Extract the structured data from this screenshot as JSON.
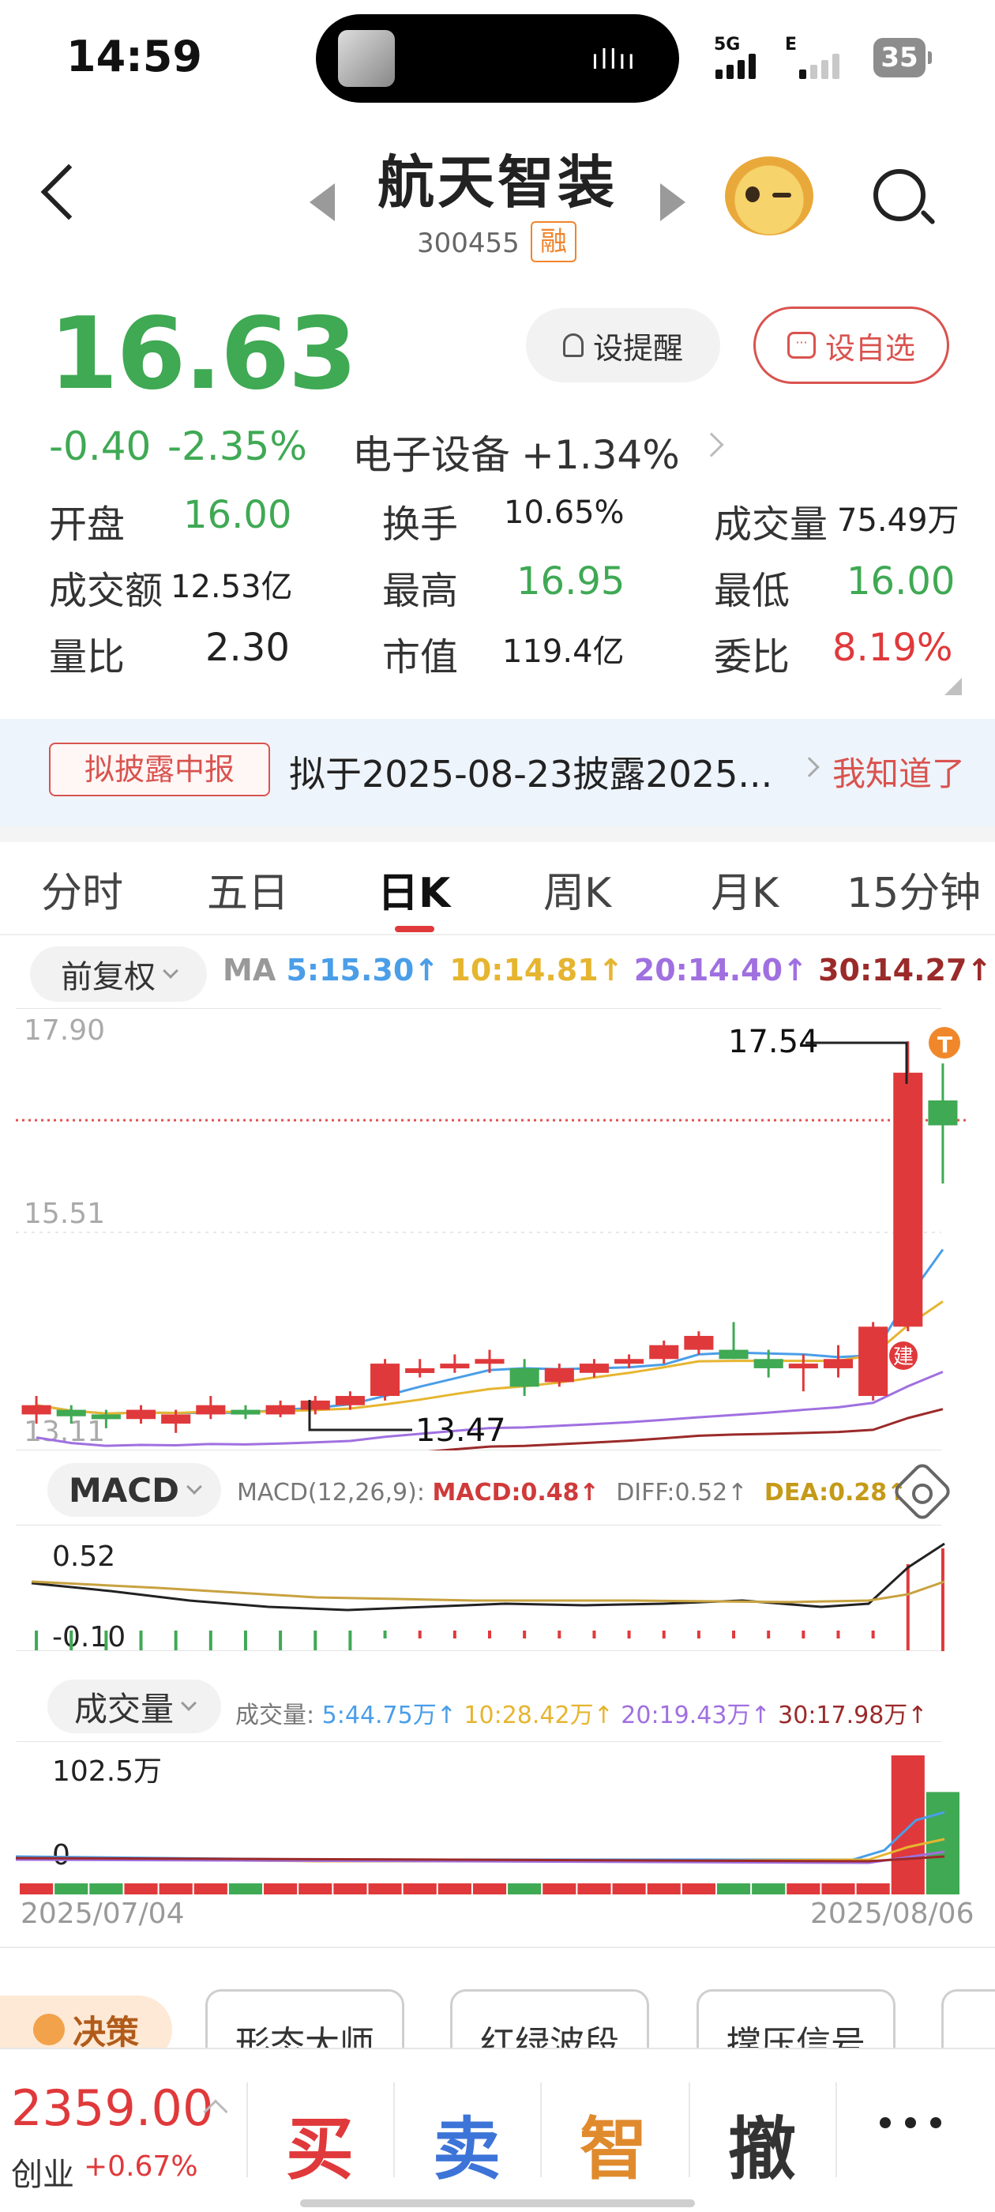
{
  "status_bar": {
    "time": "14:59",
    "net1": "5G",
    "net2": "E",
    "battery": "35"
  },
  "header": {
    "name": "航天智装",
    "code": "300455",
    "margin_tag": "融"
  },
  "quote": {
    "price": "16.63",
    "change": "-0.40",
    "change_pct": "-2.35%",
    "sector_name": "电子设备",
    "sector_pct": "+1.34%",
    "remind_label": "设提醒",
    "fav_label": "设自选",
    "fav_icon_text": "···",
    "stats": {
      "open_label": "开盘",
      "open": "16.00",
      "turnover_label": "换手",
      "turnover": "10.65%",
      "volume_label": "成交量",
      "volume": "75.49万",
      "amount_label": "成交额",
      "amount": "12.53亿",
      "high_label": "最高",
      "high": "16.95",
      "low_label": "最低",
      "low": "16.00",
      "vol_ratio_label": "量比",
      "vol_ratio": "2.30",
      "mcap_label": "市值",
      "mcap": "119.4亿",
      "commit_label": "委比",
      "commit": "8.19%"
    }
  },
  "notice": {
    "tag": "拟披露中报",
    "text": "拟于2025-08-23披露2025...",
    "action": "我知道了"
  },
  "tabs": [
    "分时",
    "五日",
    "日K",
    "周K",
    "月K",
    "15分钟"
  ],
  "active_tab": 2,
  "kchart": {
    "adjust": "前复权",
    "ma_label": "MA",
    "ma5": "5:15.30↑",
    "ma10": "10:14.81↑",
    "ma20": "20:14.40↑",
    "ma30": "30:14.27↑",
    "y_top": "17.90",
    "y_mid": "15.51",
    "y_bot": "13.11",
    "high_mark": "17.54",
    "low_mark": "13.47",
    "t_badge": "T",
    "build_badge": "建"
  },
  "macd": {
    "name": "MACD",
    "params": "MACD(12,26,9):",
    "macd": "MACD:0.48↑",
    "diff": "DIFF:0.52↑",
    "dea": "DEA:0.28↑",
    "y_top": "0.52",
    "y_bot": "-0.10"
  },
  "volume": {
    "name": "成交量",
    "label": "成交量:",
    "ma5": "5:44.75万↑",
    "ma10": "10:28.42万↑",
    "ma20": "20:19.43万↑",
    "ma30": "30:17.98万↑",
    "y_top": "102.5万",
    "y_bot": "0",
    "date_start": "2025/07/04",
    "date_end": "2025/08/06"
  },
  "features": {
    "decision": "决策",
    "items": [
      "形态大师",
      "红绿波段",
      "撑压信号"
    ]
  },
  "bottom": {
    "index_value": "2359.00",
    "index_name": "创业",
    "index_pct": "+0.67%",
    "buy": "买",
    "sell": "卖",
    "smart": "智",
    "cancel": "撤"
  },
  "colors": {
    "up": "#e0393b",
    "down": "#3fa954",
    "ma5": "#4a9ee8",
    "ma10": "#e6b530",
    "ma20": "#a070e0",
    "ma30": "#9b2a2a"
  },
  "chart_data": {
    "type": "candlestick",
    "dates": [
      "2025/07/04",
      "2025/08/06"
    ],
    "ohlc_approx": [
      [
        13.5,
        13.7,
        13.4,
        13.6
      ],
      [
        13.55,
        13.6,
        13.4,
        13.48
      ],
      [
        13.5,
        13.55,
        13.35,
        13.45
      ],
      [
        13.45,
        13.6,
        13.4,
        13.55
      ],
      [
        13.4,
        13.55,
        13.3,
        13.5
      ],
      [
        13.5,
        13.7,
        13.45,
        13.6
      ],
      [
        13.55,
        13.6,
        13.45,
        13.5
      ],
      [
        13.5,
        13.65,
        13.47,
        13.6
      ],
      [
        13.55,
        13.7,
        13.5,
        13.65
      ],
      [
        13.6,
        13.75,
        13.55,
        13.7
      ],
      [
        13.7,
        14.1,
        13.65,
        14.05
      ],
      [
        14.0,
        14.1,
        13.9,
        14.0
      ],
      [
        14.0,
        14.15,
        13.95,
        14.05
      ],
      [
        14.05,
        14.2,
        13.95,
        14.1
      ],
      [
        14.0,
        14.1,
        13.7,
        13.8
      ],
      [
        13.85,
        14.05,
        13.8,
        14.0
      ],
      [
        13.95,
        14.1,
        13.9,
        14.05
      ],
      [
        14.05,
        14.15,
        14.0,
        14.1
      ],
      [
        14.1,
        14.3,
        14.05,
        14.25
      ],
      [
        14.2,
        14.4,
        14.15,
        14.35
      ],
      [
        14.2,
        14.5,
        14.1,
        14.1
      ],
      [
        14.1,
        14.2,
        13.9,
        14.0
      ],
      [
        14.0,
        14.15,
        13.75,
        14.05
      ],
      [
        14.0,
        14.25,
        13.9,
        14.1
      ],
      [
        13.7,
        14.5,
        13.65,
        14.45
      ],
      [
        14.45,
        17.54,
        14.4,
        17.2
      ],
      [
        16.9,
        17.3,
        16.0,
        16.63
      ]
    ],
    "volume_wan_approx": [
      3,
      2,
      2,
      2,
      2,
      2,
      2,
      2,
      2,
      2,
      3,
      2,
      2,
      2,
      2,
      2,
      2,
      2,
      2,
      2,
      3,
      2,
      2,
      2,
      8,
      102.5,
      75.49
    ]
  }
}
